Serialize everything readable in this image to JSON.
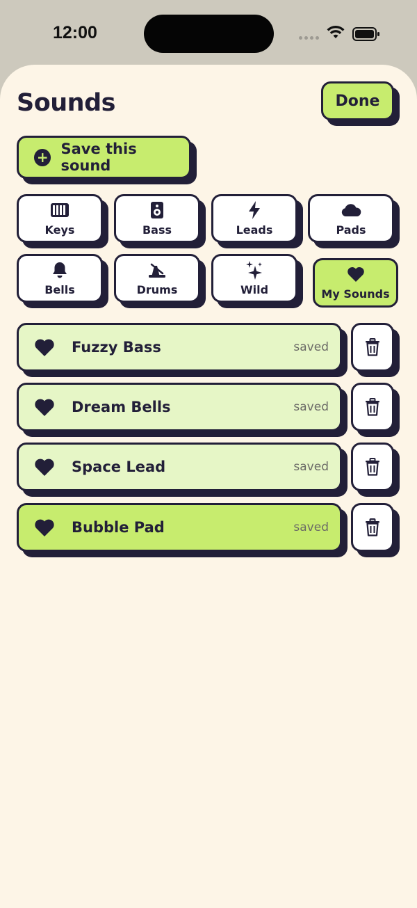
{
  "status_bar": {
    "time": "12:00",
    "icons": [
      "cellular-dots-icon",
      "wifi-icon",
      "battery-icon"
    ]
  },
  "header": {
    "title": "Sounds",
    "done_label": "Done"
  },
  "save_button": {
    "label": "Save this sound",
    "icon": "plus-circle-icon"
  },
  "categories": [
    {
      "label": "Keys",
      "icon": "piano-keys-icon",
      "selected": false
    },
    {
      "label": "Bass",
      "icon": "speaker-icon",
      "selected": false
    },
    {
      "label": "Leads",
      "icon": "lightning-icon",
      "selected": false
    },
    {
      "label": "Pads",
      "icon": "cloud-icon",
      "selected": false
    },
    {
      "label": "Bells",
      "icon": "bell-icon",
      "selected": false
    },
    {
      "label": "Drums",
      "icon": "metronome-icon",
      "selected": false
    },
    {
      "label": "Wild",
      "icon": "sparkles-icon",
      "selected": false
    },
    {
      "label": "My Sounds",
      "icon": "heart-icon",
      "selected": true
    }
  ],
  "saved_sounds": [
    {
      "name": "Fuzzy Bass",
      "status": "saved",
      "active": false
    },
    {
      "name": "Dream Bells",
      "status": "saved",
      "active": false
    },
    {
      "name": "Space Lead",
      "status": "saved",
      "active": false
    },
    {
      "name": "Bubble Pad",
      "status": "saved",
      "active": true
    }
  ],
  "colors": {
    "accent": "#c7ec6e",
    "accent_light": "#e6f6c6",
    "ink": "#221f38",
    "sheet_bg": "#fdf5e7",
    "backdrop": "#cdc9bd"
  }
}
